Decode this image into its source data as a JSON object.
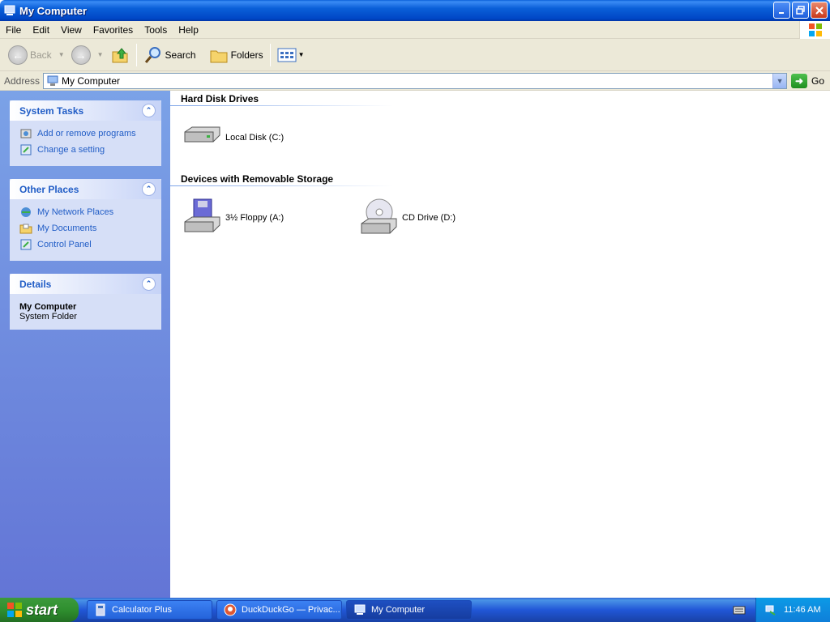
{
  "window": {
    "title": "My Computer"
  },
  "menu": [
    "File",
    "Edit",
    "View",
    "Favorites",
    "Tools",
    "Help"
  ],
  "toolbar": {
    "back_label": "Back",
    "search_label": "Search",
    "folders_label": "Folders"
  },
  "address": {
    "label": "Address",
    "value": "My Computer",
    "go_label": "Go"
  },
  "left_panel": {
    "system_tasks": {
      "title": "System Tasks",
      "items": [
        "Add or remove programs",
        "Change a setting"
      ]
    },
    "other_places": {
      "title": "Other Places",
      "items": [
        "My Network Places",
        "My Documents",
        "Control Panel"
      ]
    },
    "details": {
      "title": "Details",
      "name": "My Computer",
      "type": "System Folder"
    }
  },
  "content": {
    "groups": [
      {
        "title": "Hard Disk Drives",
        "items": [
          "Local Disk (C:)"
        ]
      },
      {
        "title": "Devices with Removable Storage",
        "items": [
          "3½ Floppy (A:)",
          "CD Drive (D:)"
        ]
      }
    ]
  },
  "taskbar": {
    "start_label": "start",
    "buttons": [
      "Calculator Plus",
      "DuckDuckGo — Privac...",
      "My Computer"
    ],
    "active_index": 2,
    "clock": "11:46 AM"
  },
  "colors": {
    "titlebar": "#0a5fd8",
    "link": "#215dc6",
    "panel": "#7ba2e7",
    "start": "#2f8f2f"
  }
}
